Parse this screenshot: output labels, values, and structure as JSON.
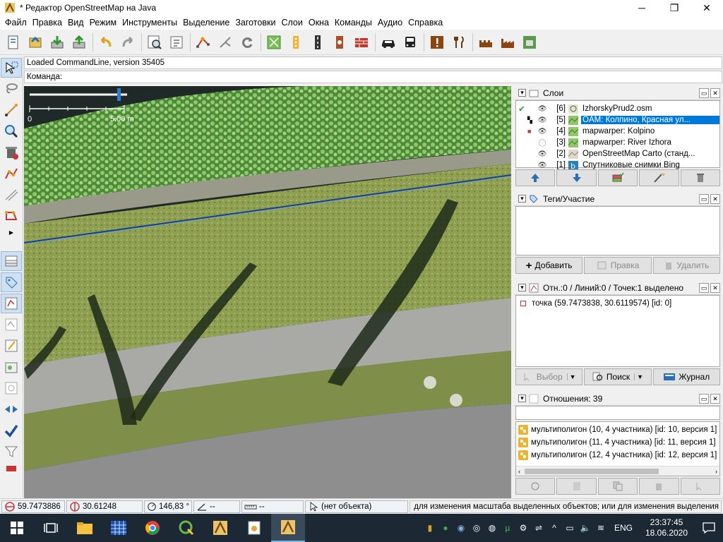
{
  "window": {
    "title": "* Редактор OpenStreetMap на Java"
  },
  "menu": [
    "Файл",
    "Правка",
    "Вид",
    "Режим",
    "Инструменты",
    "Выделение",
    "Заготовки",
    "Слои",
    "Окна",
    "Команды",
    "Аудио",
    "Справка"
  ],
  "commandline": {
    "status_text": "Loaded CommandLine, version 35405",
    "prompt_label": "Команда:"
  },
  "map": {
    "scale_left": "0",
    "scale_right": "5.00 m"
  },
  "layers_panel": {
    "title": "Слои",
    "layers": [
      {
        "num": "[6]",
        "name": "IzhorskyPrud2.osm",
        "active": true,
        "visible": true
      },
      {
        "num": "[5]",
        "name": "OAM: Колпино, Красная ул...",
        "selected": true,
        "visible": true
      },
      {
        "num": "[4]",
        "name": "mapwarper: Kolpino",
        "visible": true
      },
      {
        "num": "[3]",
        "name": "mapwarper: River Izhora",
        "visible": false
      },
      {
        "num": "[2]",
        "name": "OpenStreetMap Carto (станд...",
        "visible": true
      },
      {
        "num": "[1]",
        "name": "Спутниковые снимки Bing",
        "visible": true
      }
    ]
  },
  "tags_panel": {
    "title": "Теги/Участие",
    "add_label": "Добавить",
    "edit_label": "Правка",
    "delete_label": "Удалить"
  },
  "selection_panel": {
    "title": "Отн.:0 / Линий:0 / Точек:1 выделено",
    "items": [
      "точка (59.7473838, 30.6119574) [id: 0]"
    ],
    "select_label": "Выбор",
    "search_label": "Поиск",
    "history_label": "Журнал"
  },
  "relations_panel": {
    "title": "Отношения: 39",
    "items": [
      "мультиполигон (10, 4 участника) [id: 10, версия 1]",
      "мультиполигон (11, 4 участника) [id: 11, версия 1]",
      "мультиполигон (12, 4 участника) [id: 12, версия 1]"
    ]
  },
  "statusbar": {
    "lat": "59.7473886",
    "lon": "30.61248",
    "heading": "146,83 °",
    "angle": "--",
    "length": "--",
    "object": "(нет объекта)",
    "help": "для изменения масштаба выделенных объектов; или для изменения выделения"
  },
  "taskbar": {
    "lang": "ENG",
    "time": "23:37:45",
    "date": "18.06.2020"
  },
  "colors": {
    "selection": "#0078d7",
    "taskbar": "#1c2833",
    "map_way": "#1a3f8f"
  }
}
